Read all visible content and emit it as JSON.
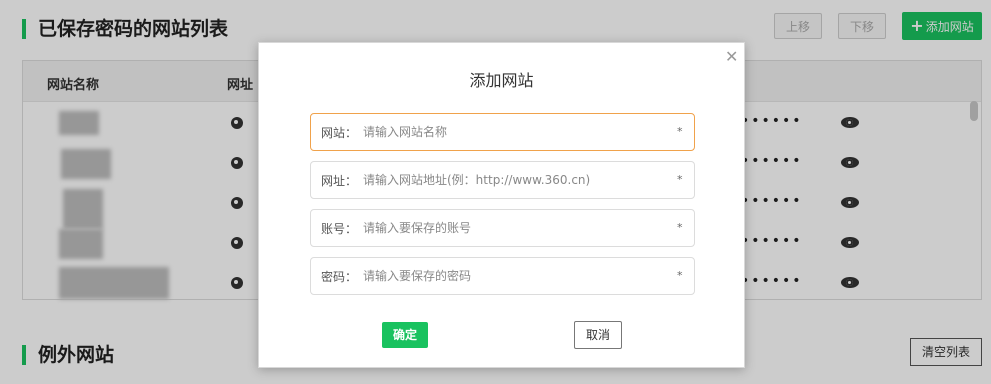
{
  "saved_section": {
    "title": "已保存密码的网站列表",
    "move_up_label": "上移",
    "move_down_label": "下移",
    "add_site_label": "添加网站"
  },
  "table": {
    "columns": [
      "网站名称",
      "网址"
    ],
    "rows": [
      {
        "password_mask": "••••••"
      },
      {
        "password_mask": "••••••"
      },
      {
        "password_mask": "••••••"
      },
      {
        "password_mask": "••••••"
      },
      {
        "password_mask": "••••••"
      }
    ]
  },
  "exception_section": {
    "title": "例外网站",
    "clear_list_label": "清空列表"
  },
  "modal": {
    "title": "添加网站",
    "close_glyph": "✕",
    "fields": [
      {
        "label": "网站：",
        "placeholder": "请输入网站名称",
        "required": "*"
      },
      {
        "label": "网址：",
        "placeholder": "请输入网站地址(例：http://www.360.cn)",
        "required": "*"
      },
      {
        "label": "账号：",
        "placeholder": "请输入要保存的账号",
        "required": "*"
      },
      {
        "label": "密码：",
        "placeholder": "请输入要保存的密码",
        "required": "*"
      }
    ],
    "confirm_label": "确定",
    "cancel_label": "取消"
  },
  "colors": {
    "accent": "#19c25f",
    "focus_border": "#f0a24b"
  },
  "icons": [
    "globe-icon",
    "eye-icon",
    "plus-icon",
    "close-icon"
  ]
}
